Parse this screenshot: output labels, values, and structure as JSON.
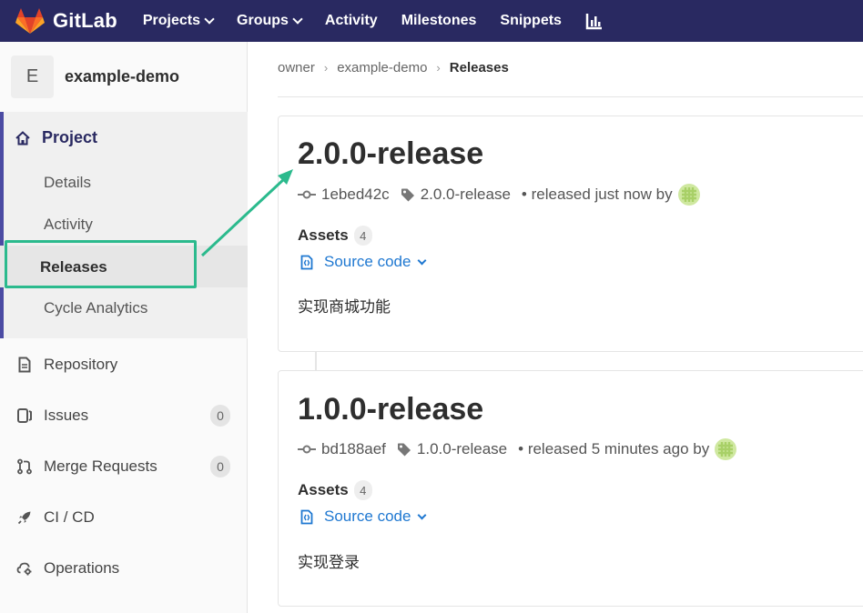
{
  "topbar": {
    "app_name": "GitLab",
    "nav": [
      "Projects",
      "Groups",
      "Activity",
      "Milestones",
      "Snippets"
    ],
    "colors": {
      "background": "#292961"
    }
  },
  "sidebar": {
    "project_initial": "E",
    "project_name": "example-demo",
    "section_title": "Project",
    "sub_items": [
      "Details",
      "Activity",
      "Releases",
      "Cycle Analytics"
    ],
    "active_item": "Releases",
    "items": [
      {
        "label": "Repository",
        "icon": "document-icon"
      },
      {
        "label": "Issues",
        "icon": "issues-icon",
        "count": "0"
      },
      {
        "label": "Merge Requests",
        "icon": "merge-request-icon",
        "count": "0"
      },
      {
        "label": "CI / CD",
        "icon": "rocket-icon"
      },
      {
        "label": "Operations",
        "icon": "cloud-gear-icon"
      }
    ],
    "colors": {
      "accent": "#4b4ba3",
      "highlight": "#2bba8d"
    }
  },
  "breadcrumb": [
    "owner",
    "example-demo",
    "Releases"
  ],
  "releases": [
    {
      "title": "2.0.0-release",
      "commit": "1ebed42c",
      "tag": "2.0.0-release",
      "released_text": "• released just now by",
      "assets_label": "Assets",
      "assets_count": "4",
      "source_label": "Source code",
      "description": "实现商城功能"
    },
    {
      "title": "1.0.0-release",
      "commit": "bd188aef",
      "tag": "1.0.0-release",
      "released_text": "• released 5 minutes ago by",
      "assets_label": "Assets",
      "assets_count": "4",
      "source_label": "Source code",
      "description": "实现登录"
    }
  ]
}
